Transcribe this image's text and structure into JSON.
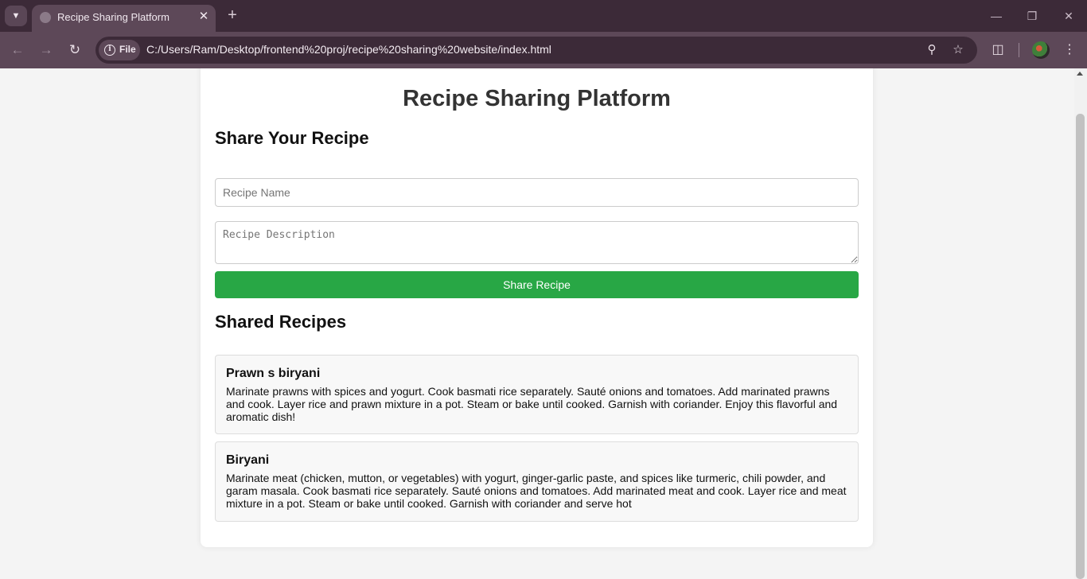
{
  "browser": {
    "tab_title": "Recipe Sharing Platform",
    "site_info_label": "File",
    "url": "C:/Users/Ram/Desktop/frontend%20proj/recipe%20sharing%20website/index.html"
  },
  "page": {
    "title": "Recipe Sharing Platform",
    "share_heading": "Share Your Recipe",
    "name_placeholder": "Recipe Name",
    "description_placeholder": "Recipe Description",
    "share_button_label": "Share Recipe",
    "shared_heading": "Shared Recipes",
    "recipes": [
      {
        "name": "Prawn s biryani",
        "description": "Marinate prawns with spices and yogurt. Cook basmati rice separately. Sauté onions and tomatoes. Add marinated prawns and cook. Layer rice and prawn mixture in a pot. Steam or bake until cooked. Garnish with coriander. Enjoy this flavorful and aromatic dish!"
      },
      {
        "name": "Biryani",
        "description": "Marinate meat (chicken, mutton, or vegetables) with yogurt, ginger-garlic paste, and spices like turmeric, chili powder, and garam masala. Cook basmati rice separately. Sauté onions and tomatoes. Add marinated meat and cook. Layer rice and meat mixture in a pot. Steam or bake until cooked. Garnish with coriander and serve hot"
      }
    ]
  },
  "colors": {
    "accent_button": "#28a745",
    "page_background": "#f4f4f4",
    "tabbar": "#3c2a38",
    "toolbar": "#5d4858"
  }
}
